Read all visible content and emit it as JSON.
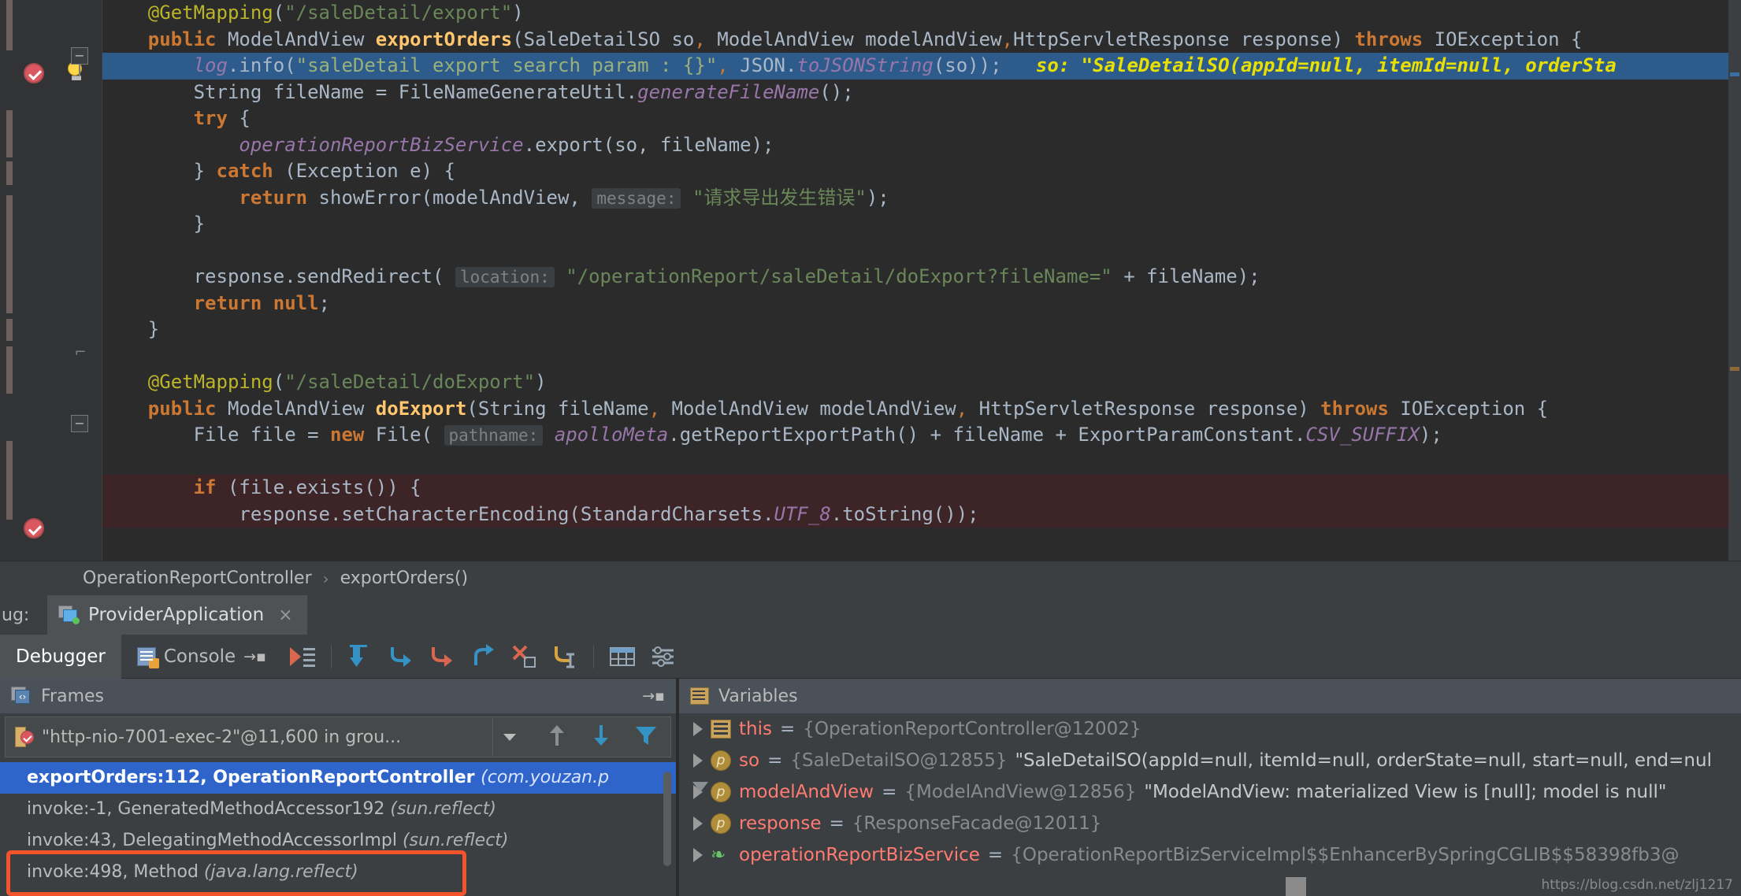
{
  "editor": {
    "lines": [
      {
        "indent": 4,
        "tokens": [
          {
            "t": "@GetMapping",
            "c": "ann"
          },
          {
            "t": "(",
            "c": "punc"
          },
          {
            "t": "\"/saleDetail/export\"",
            "c": "str"
          },
          {
            "t": ")",
            "c": "punc"
          }
        ]
      },
      {
        "indent": 4,
        "tokens": [
          {
            "t": "public ",
            "c": "kw"
          },
          {
            "t": "ModelAndView ",
            "c": "typ"
          },
          {
            "t": "exportOrders",
            "c": "mth"
          },
          {
            "t": "(",
            "c": "punc"
          },
          {
            "t": "SaleDetailSO so",
            "c": "typ"
          },
          {
            "t": ",",
            "c": "comma"
          },
          {
            "t": " ModelAndView modelAndView",
            "c": "typ"
          },
          {
            "t": ",",
            "c": "comma"
          },
          {
            "t": "HttpServletResponse response",
            "c": "typ"
          },
          {
            "t": ") ",
            "c": "punc"
          },
          {
            "t": "throws ",
            "c": "kw"
          },
          {
            "t": "IOException ",
            "c": "typ"
          },
          {
            "t": "{",
            "c": "punc"
          }
        ]
      },
      {
        "indent": 8,
        "highlight": true,
        "tokens": [
          {
            "t": "log",
            "c": "fld"
          },
          {
            "t": ".info(",
            "c": "punc"
          },
          {
            "t": "\"saleDetail export search param : {}\"",
            "c": "str"
          },
          {
            "t": ",",
            "c": "comma"
          },
          {
            "t": " JSON.",
            "c": "punc"
          },
          {
            "t": "toJSONString",
            "c": "fld"
          },
          {
            "t": "(so));",
            "c": "punc"
          },
          {
            "t": "   so: \"SaleDetailSO(appId=null, itemId=null, orderSta",
            "c": "dbg"
          }
        ]
      },
      {
        "indent": 8,
        "tokens": [
          {
            "t": "String fileName ",
            "c": "typ"
          },
          {
            "t": "= ",
            "c": "punc"
          },
          {
            "t": "FileNameGenerateUtil.",
            "c": "typ"
          },
          {
            "t": "generateFileName",
            "c": "fld"
          },
          {
            "t": "();",
            "c": "punc"
          }
        ]
      },
      {
        "indent": 8,
        "tokens": [
          {
            "t": "try ",
            "c": "kw"
          },
          {
            "t": "{",
            "c": "punc"
          }
        ]
      },
      {
        "indent": 12,
        "tokens": [
          {
            "t": "operationReportBizService",
            "c": "fld"
          },
          {
            "t": ".export(so, fileName);",
            "c": "punc"
          }
        ]
      },
      {
        "indent": 8,
        "tokens": [
          {
            "t": "} ",
            "c": "punc"
          },
          {
            "t": "catch ",
            "c": "kw"
          },
          {
            "t": "(Exception e) {",
            "c": "punc"
          }
        ]
      },
      {
        "indent": 12,
        "tokens": [
          {
            "t": "return ",
            "c": "kw"
          },
          {
            "t": "showError(modelAndView, ",
            "c": "punc"
          },
          {
            "t": " message: ",
            "c": "hint"
          },
          {
            "t": "\"请求导出发生错误\"",
            "c": "str"
          },
          {
            "t": ");",
            "c": "punc"
          }
        ]
      },
      {
        "indent": 8,
        "tokens": [
          {
            "t": "}",
            "c": "punc"
          }
        ]
      },
      {
        "indent": 0,
        "tokens": []
      },
      {
        "indent": 8,
        "tokens": [
          {
            "t": "response.sendRedirect( ",
            "c": "punc"
          },
          {
            "t": "location: ",
            "c": "hint"
          },
          {
            "t": "\"/operationReport/saleDetail/doExport?fileName=\"",
            "c": "str"
          },
          {
            "t": " + fileName);",
            "c": "punc"
          }
        ]
      },
      {
        "indent": 8,
        "tokens": [
          {
            "t": "return ",
            "c": "kw"
          },
          {
            "t": "null",
            "c": "kw"
          },
          {
            "t": ";",
            "c": "punc"
          }
        ]
      },
      {
        "indent": 4,
        "tokens": [
          {
            "t": "}",
            "c": "punc"
          }
        ]
      },
      {
        "indent": 0,
        "tokens": []
      },
      {
        "indent": 4,
        "tokens": [
          {
            "t": "@GetMapping",
            "c": "ann"
          },
          {
            "t": "(",
            "c": "punc"
          },
          {
            "t": "\"/saleDetail/doExport\"",
            "c": "str"
          },
          {
            "t": ")",
            "c": "punc"
          }
        ]
      },
      {
        "indent": 4,
        "tokens": [
          {
            "t": "public ",
            "c": "kw"
          },
          {
            "t": "ModelAndView ",
            "c": "typ"
          },
          {
            "t": "doExport",
            "c": "mth"
          },
          {
            "t": "(",
            "c": "punc"
          },
          {
            "t": "String fileName",
            "c": "typ"
          },
          {
            "t": ",",
            "c": "comma"
          },
          {
            "t": " ModelAndView modelAndView",
            "c": "typ"
          },
          {
            "t": ",",
            "c": "comma"
          },
          {
            "t": " HttpServletResponse response",
            "c": "typ"
          },
          {
            "t": ") ",
            "c": "punc"
          },
          {
            "t": "throws ",
            "c": "kw"
          },
          {
            "t": "IOException ",
            "c": "typ"
          },
          {
            "t": "{",
            "c": "punc"
          }
        ]
      },
      {
        "indent": 8,
        "tokens": [
          {
            "t": "File file ",
            "c": "typ"
          },
          {
            "t": "= ",
            "c": "punc"
          },
          {
            "t": "new ",
            "c": "kw"
          },
          {
            "t": "File( ",
            "c": "punc"
          },
          {
            "t": " pathname: ",
            "c": "hint"
          },
          {
            "t": "apolloMeta",
            "c": "fld"
          },
          {
            "t": ".getReportExportPath() + fileName + ExportParamConstant.",
            "c": "punc"
          },
          {
            "t": "CSV_SUFFIX",
            "c": "cst"
          },
          {
            "t": ");",
            "c": "punc"
          }
        ]
      },
      {
        "indent": 0,
        "tokens": []
      },
      {
        "indent": 8,
        "errbg": true,
        "tokens": [
          {
            "t": "if ",
            "c": "kw"
          },
          {
            "t": "(file.exists()) {",
            "c": "punc"
          }
        ]
      },
      {
        "indent": 12,
        "errbg": true,
        "tokens": [
          {
            "t": "response.setCharacterEncoding(StandardCharsets.",
            "c": "punc"
          },
          {
            "t": "UTF_8",
            "c": "cst"
          },
          {
            "t": ".toString());",
            "c": "punc"
          }
        ]
      }
    ]
  },
  "breadcrumb": {
    "items": [
      "OperationReportController",
      "exportOrders()"
    ],
    "separator": "›"
  },
  "debug_window": {
    "label": "ug:",
    "session_tab": "ProviderApplication",
    "close_glyph": "×",
    "tabs": [
      {
        "label": "Debugger",
        "active": true
      },
      {
        "label": "Console",
        "active": false
      }
    ],
    "pin_glyph": "→▪"
  },
  "frames": {
    "title": "Frames",
    "dock_glyph": "→▪",
    "thread": "\"http-nio-7001-exec-2\"@11,600 in grou...",
    "items": [
      {
        "text": "exportOrders:112, OperationReportController",
        "pkg": "(com.youzan.p",
        "selected": true
      },
      {
        "text": "invoke:-1, GeneratedMethodAccessor192",
        "pkg": "(sun.reflect)",
        "selected": false
      },
      {
        "text": "invoke:43, DelegatingMethodAccessorImpl",
        "pkg": "(sun.reflect)",
        "selected": false
      },
      {
        "text": "invoke:498, Method",
        "pkg": "(java.lang.reflect)",
        "selected": false
      }
    ],
    "highlight_color": "#f2532a",
    "selection_color": "#2f65ca"
  },
  "variables": {
    "title": "Variables",
    "rows": [
      {
        "icon": "this-icon",
        "name": "this",
        "eq": " = ",
        "ref": "{OperationReportController@12002}",
        "str": ""
      },
      {
        "icon": "param-icon",
        "name": "so",
        "eq": " = ",
        "ref": "{SaleDetailSO@12855}",
        "str": "\"SaleDetailSO(appId=null, itemId=null, orderState=null, start=null, end=nul"
      },
      {
        "icon": "param-icon",
        "name": "modelAndView",
        "eq": " = ",
        "ref": "{ModelAndView@12856}",
        "str": "\"ModelAndView: materialized View is [null]; model is null\""
      },
      {
        "icon": "param-icon",
        "name": "response",
        "eq": " = ",
        "ref": "{ResponseFacade@12011}",
        "str": ""
      },
      {
        "icon": "spring-bean-icon",
        "name": "operationReportBizService",
        "eq": " = ",
        "ref": "{OperationReportBizServiceImpl$$EnhancerBySpringCGLIB$$58398fb3@",
        "str": ""
      }
    ],
    "watermark": "https://blog.csdn.net/zlj1217"
  },
  "colors": {
    "editor_bg": "#2b2b2b",
    "panel_bg": "#3c3f41",
    "exec_line": "#2d5c8c",
    "error_line": "#3d2426",
    "inline_debug_text": "#e8e000"
  }
}
